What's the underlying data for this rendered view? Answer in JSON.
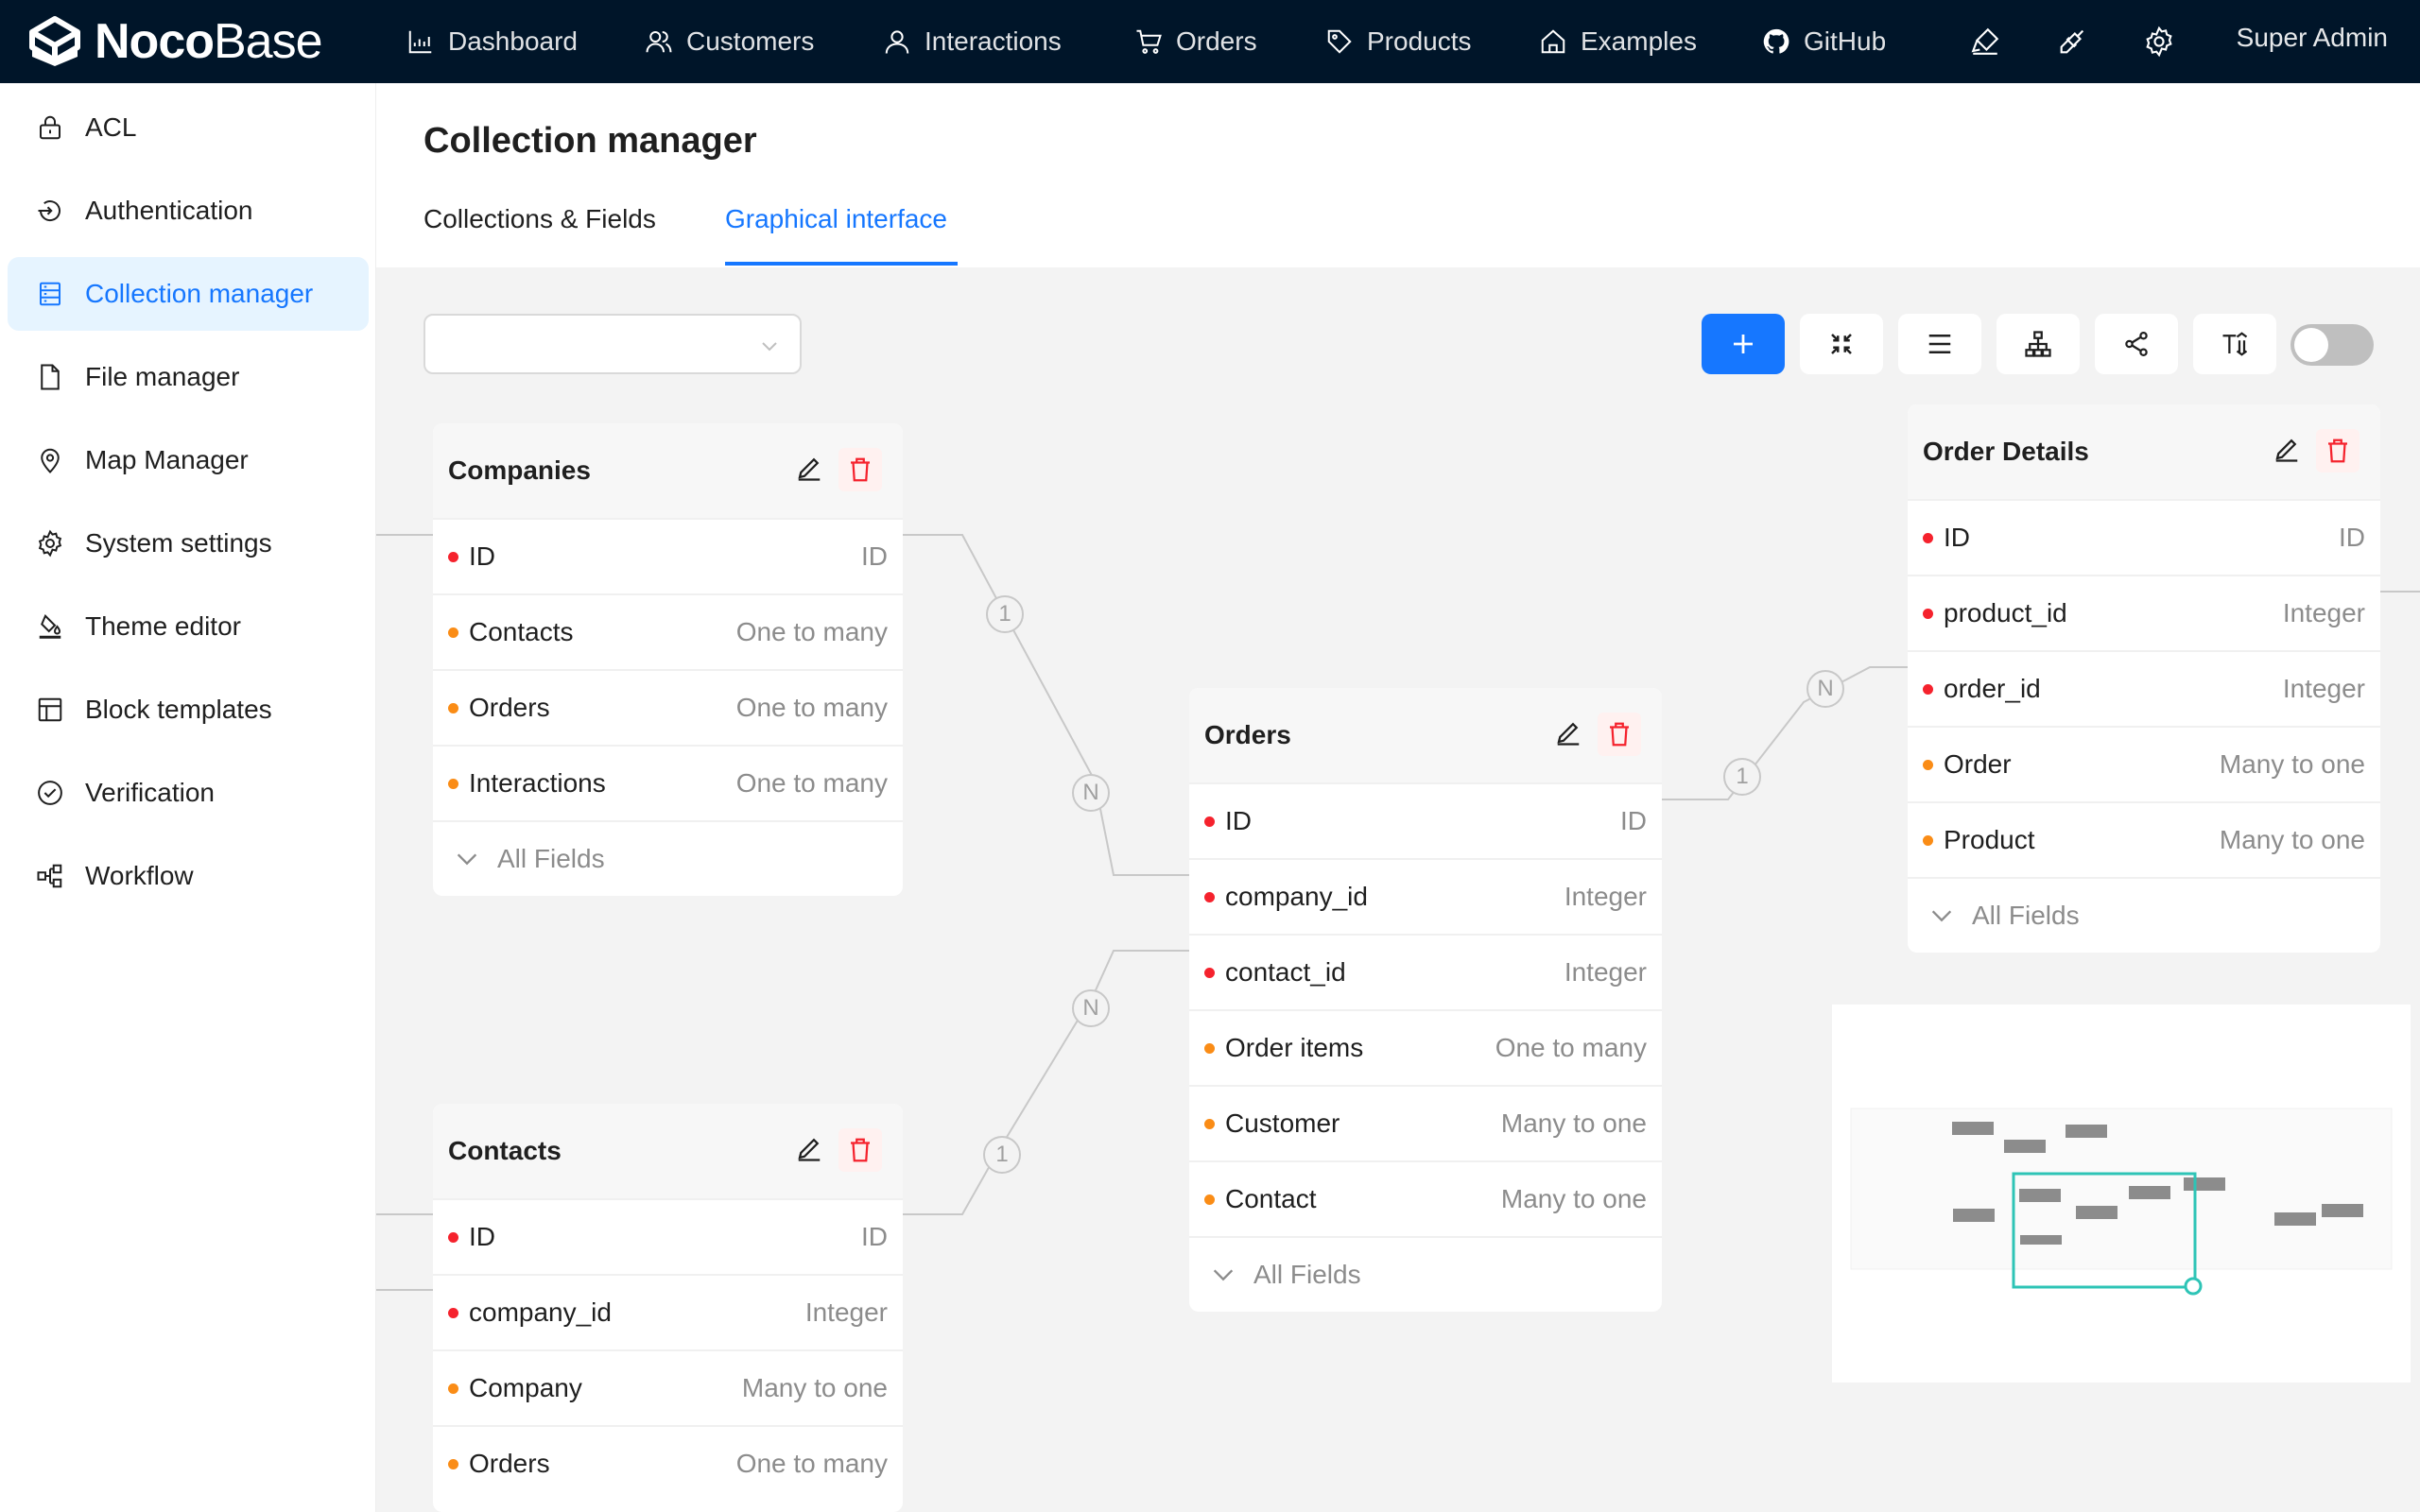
{
  "brand": {
    "name_bold": "Noco",
    "name_light": "Base"
  },
  "topnav": [
    {
      "label": "Dashboard",
      "icon": "bar-chart-icon"
    },
    {
      "label": "Customers",
      "icon": "team-icon"
    },
    {
      "label": "Interactions",
      "icon": "user-icon"
    },
    {
      "label": "Orders",
      "icon": "shopping-cart-icon"
    },
    {
      "label": "Products",
      "icon": "tag-icon"
    },
    {
      "label": "Examples",
      "icon": "home-icon"
    },
    {
      "label": "GitHub",
      "icon": "github-icon"
    }
  ],
  "top_icons": [
    "highlight-icon",
    "plugin-icon",
    "setting-icon"
  ],
  "user": {
    "name": "Super Admin"
  },
  "sidebar": {
    "items": [
      {
        "label": "ACL",
        "icon": "lock-icon"
      },
      {
        "label": "Authentication",
        "icon": "login-icon"
      },
      {
        "label": "Collection manager",
        "icon": "database-icon",
        "active": true
      },
      {
        "label": "File manager",
        "icon": "file-icon"
      },
      {
        "label": "Map Manager",
        "icon": "environment-icon"
      },
      {
        "label": "System settings",
        "icon": "setting-icon"
      },
      {
        "label": "Theme editor",
        "icon": "bg-colors-icon"
      },
      {
        "label": "Block templates",
        "icon": "layout-icon"
      },
      {
        "label": "Verification",
        "icon": "check-circle-icon"
      },
      {
        "label": "Workflow",
        "icon": "partition-icon"
      }
    ]
  },
  "page": {
    "title": "Collection manager",
    "tabs": [
      {
        "label": "Collections & Fields",
        "active": false
      },
      {
        "label": "Graphical interface",
        "active": true
      }
    ]
  },
  "canvas": {
    "collection_select": {
      "value": ""
    },
    "tools": [
      "plus-icon",
      "fullscreen-exit-icon",
      "menu-icon",
      "apartment-icon",
      "share-icon",
      "font-size-icon"
    ],
    "switch": {
      "on": false
    },
    "collections": {
      "companies": {
        "title": "Companies",
        "fields": [
          {
            "name": "ID",
            "type": "ID",
            "kind": "red"
          },
          {
            "name": "Contacts",
            "type": "One to many",
            "kind": "orange"
          },
          {
            "name": "Orders",
            "type": "One to many",
            "kind": "orange"
          },
          {
            "name": "Interactions",
            "type": "One to many",
            "kind": "orange"
          }
        ],
        "all_fields": "All Fields"
      },
      "contacts": {
        "title": "Contacts",
        "fields": [
          {
            "name": "ID",
            "type": "ID",
            "kind": "red"
          },
          {
            "name": "company_id",
            "type": "Integer",
            "kind": "red"
          },
          {
            "name": "Company",
            "type": "Many to one",
            "kind": "orange"
          },
          {
            "name": "Orders",
            "type": "One to many",
            "kind": "orange"
          }
        ]
      },
      "orders": {
        "title": "Orders",
        "fields": [
          {
            "name": "ID",
            "type": "ID",
            "kind": "red"
          },
          {
            "name": "company_id",
            "type": "Integer",
            "kind": "red"
          },
          {
            "name": "contact_id",
            "type": "Integer",
            "kind": "red"
          },
          {
            "name": "Order items",
            "type": "One to many",
            "kind": "orange"
          },
          {
            "name": "Customer",
            "type": "Many to one",
            "kind": "orange"
          },
          {
            "name": "Contact",
            "type": "Many to one",
            "kind": "orange"
          }
        ],
        "all_fields": "All Fields"
      },
      "order_details": {
        "title": "Order Details",
        "fields": [
          {
            "name": "ID",
            "type": "ID",
            "kind": "red"
          },
          {
            "name": "product_id",
            "type": "Integer",
            "kind": "red"
          },
          {
            "name": "order_id",
            "type": "Integer",
            "kind": "red"
          },
          {
            "name": "Order",
            "type": "Many to one",
            "kind": "orange"
          },
          {
            "name": "Product",
            "type": "Many to one",
            "kind": "orange"
          }
        ],
        "all_fields": "All Fields"
      }
    },
    "edge_labels": {
      "companies_orders": {
        "from": "1",
        "to": "N"
      },
      "contacts_orders": {
        "from": "1",
        "to": "N"
      },
      "orders_order_details": {
        "from": "1",
        "to": "N"
      }
    }
  },
  "colors": {
    "accent": "#1677ff",
    "header_bg": "#001529",
    "required_dot": "#f5222d",
    "relation_dot": "#fa8c16",
    "minimap_viewport": "#2ec4b6"
  }
}
